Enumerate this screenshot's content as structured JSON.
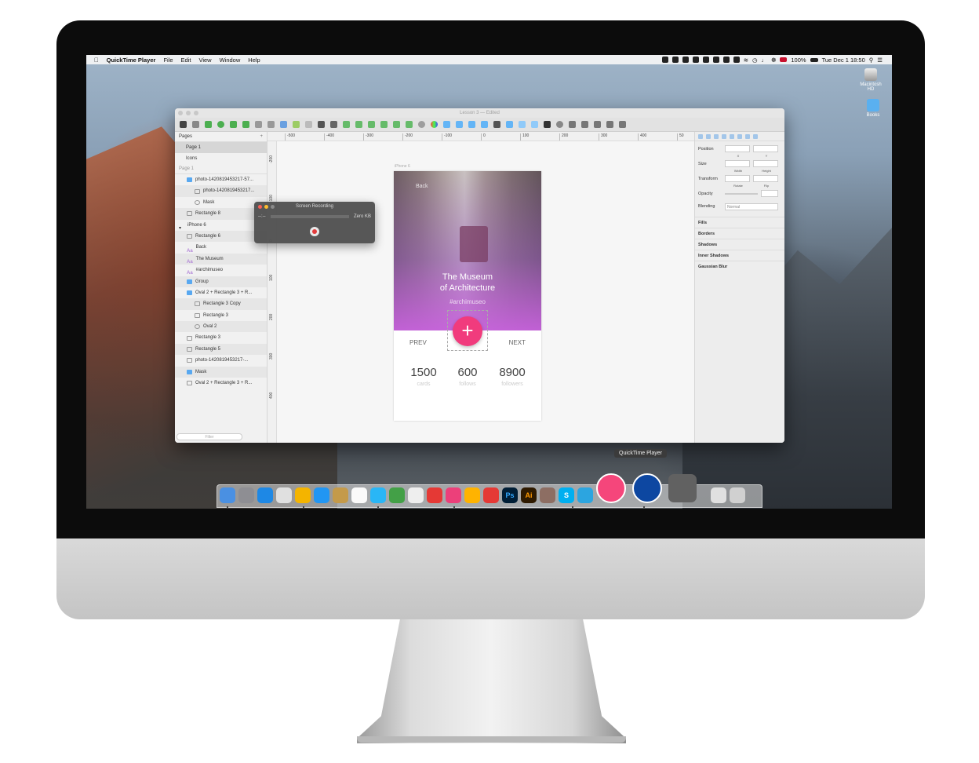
{
  "menubar": {
    "app": "QuickTime Player",
    "items": [
      "File",
      "Edit",
      "View",
      "Window",
      "Help"
    ],
    "battery": "100%",
    "clock": "Tue Dec 1 18:50"
  },
  "desktop": {
    "icons": [
      {
        "label": "Macintosh HD",
        "icon": "hard-drive-icon"
      },
      {
        "label": "Books",
        "icon": "folder-icon"
      }
    ]
  },
  "sketch": {
    "title": "Lesson 3 — Edited",
    "pages_label": "Pages",
    "pages": [
      "Page 1",
      "Icons"
    ],
    "current_page_label": "Page 1",
    "layers": [
      {
        "label": "photo-1420819453217-57...",
        "indent": 1,
        "kind": "folder"
      },
      {
        "label": "photo-1420819453217...",
        "indent": 2,
        "kind": "image"
      },
      {
        "label": "Mask",
        "indent": 2,
        "kind": "circle"
      },
      {
        "label": "Rectangle 8",
        "indent": 1,
        "kind": "rect"
      },
      {
        "label": "iPhone 6",
        "indent": 0,
        "kind": "artboard"
      },
      {
        "label": "Rectangle 6",
        "indent": 1,
        "kind": "rect"
      },
      {
        "label": "Back",
        "indent": 1,
        "kind": "text"
      },
      {
        "label": "The Museum",
        "indent": 1,
        "kind": "text"
      },
      {
        "label": "#archimuseo",
        "indent": 1,
        "kind": "text"
      },
      {
        "label": "Group",
        "indent": 1,
        "kind": "folder"
      },
      {
        "label": "Oval 2 + Rectangle 3 + R...",
        "indent": 1,
        "kind": "folder"
      },
      {
        "label": "Rectangle 3 Copy",
        "indent": 2,
        "kind": "line"
      },
      {
        "label": "Rectangle 3",
        "indent": 2,
        "kind": "line"
      },
      {
        "label": "Oval 2",
        "indent": 2,
        "kind": "circle"
      },
      {
        "label": "Rectangle 3",
        "indent": 1,
        "kind": "rect"
      },
      {
        "label": "Rectangle 5",
        "indent": 1,
        "kind": "rect"
      },
      {
        "label": "photo-1420819453217-...",
        "indent": 1,
        "kind": "image"
      },
      {
        "label": "Mask",
        "indent": 1,
        "kind": "folder"
      },
      {
        "label": "Oval 2 + Rectangle 3 + R...",
        "indent": 1,
        "kind": "rect"
      }
    ],
    "filter_placeholder": "Filter",
    "ruler_h": [
      "-500",
      "-400",
      "-300",
      "-200",
      "-100",
      "0",
      "100",
      "200",
      "300",
      "400",
      "50"
    ],
    "ruler_v": [
      "-200",
      "-100",
      "0",
      "100",
      "200",
      "300",
      "400"
    ],
    "artboard_label": "iPhone 6",
    "inspector": {
      "position": "Position",
      "x": "X",
      "y": "Y",
      "size": "Size",
      "width": "Width",
      "height": "Height",
      "transform": "Transform",
      "rotate": "Rotate",
      "flip": "Flip",
      "opacity": "Opacity",
      "blending": "Blending",
      "blending_value": "Normal",
      "sections": [
        "Fills",
        "Borders",
        "Shadows",
        "Inner Shadows",
        "Gaussian Blur"
      ]
    }
  },
  "card": {
    "back": "Back",
    "title_line1": "The Museum",
    "title_line2": "of Architecture",
    "hashtag": "#archimuseo",
    "plus": "+",
    "prev": "PREV",
    "next": "NEXT",
    "stats": [
      {
        "value": "1500",
        "label": "cards"
      },
      {
        "value": "600",
        "label": "follows"
      },
      {
        "value": "8900",
        "label": "followers"
      }
    ],
    "accent": "#f13b7d",
    "gradient_end": "#c661dc"
  },
  "recording": {
    "title": "Screen Recording",
    "time": "--:--",
    "size": "Zero KB"
  },
  "dock": {
    "tooltip": "QuickTime Player",
    "apps": [
      "Finder",
      "Launchpad",
      "Safari",
      "Calculator",
      "Chrome",
      "App Store",
      "Notes",
      "Calendar",
      "Tweetbot",
      "Evernote",
      "Photos",
      "Wunderlist",
      "Screen",
      "Sketch",
      "Dropbox",
      "Photoshop",
      "Illustrator",
      "Guitar",
      "Skype",
      "Telegram",
      "iTunes",
      "QuickTime Player",
      "System Preferences",
      "Downloads",
      "Trash"
    ],
    "labels": {
      "photoshop": "Ps",
      "illustrator": "Ai",
      "skype": "S"
    }
  }
}
